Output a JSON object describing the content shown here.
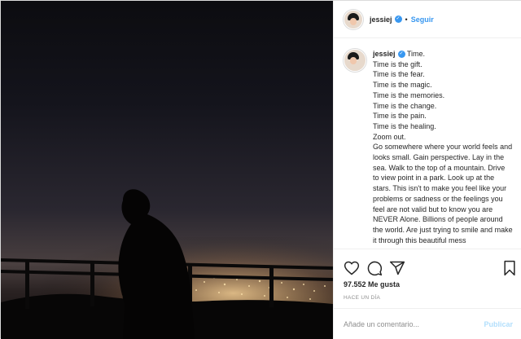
{
  "post": {
    "username": "jessiej",
    "follow_label": "Seguir",
    "separator": "•",
    "caption_lines": [
      "Time.",
      "Time is the gift.",
      "Time is the fear.",
      "Time is the magic.",
      "Time is the memories.",
      "Time is the change.",
      "Time is the pain.",
      "Time is the healing.",
      "Zoom out.",
      "Go somewhere where your world feels and looks small. Gain perspective. Lay in the sea. Walk to the top of a mountain. Drive to view point in a park. Look up at the stars. This isn't to make you feel like your problems or sadness or the feelings you feel are not valid but to know you are NEVER Alone. Billions of people around the world. Are just trying to smile and make it through this beautiful mess"
    ],
    "likes": "97.552 Me gusta",
    "timestamp": "HACE UN DÍA",
    "comment_placeholder": "Añade un comentario...",
    "publish_label": "Publicar"
  },
  "icons": {
    "like": "heart-icon",
    "comment": "comment-icon",
    "share": "share-icon",
    "save": "bookmark-icon",
    "verified": "verified-badge-icon"
  },
  "colors": {
    "accent": "#3897f0",
    "publish_disabled": "#b2dffc"
  }
}
